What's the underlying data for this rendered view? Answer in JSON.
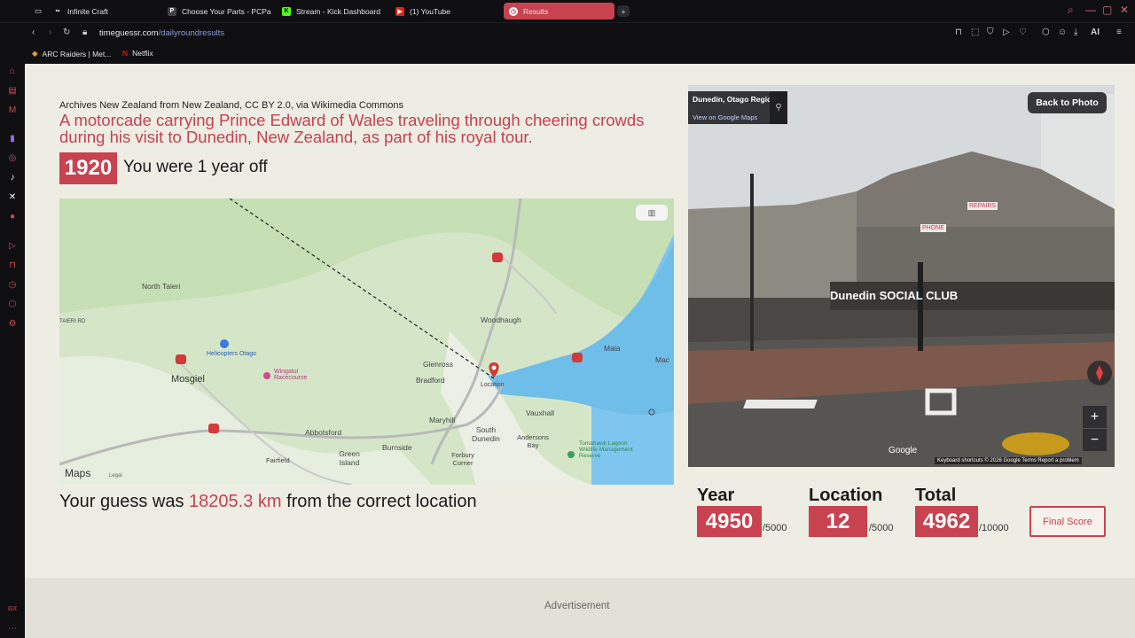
{
  "browser": {
    "tabs": [
      {
        "label": "Infinite Craft",
        "icon": "infinity-icon"
      },
      {
        "label": "Choose Your Parts - PCPa",
        "icon": "pcpartpicker-icon"
      },
      {
        "label": "Stream - Kick Dashboard",
        "icon": "kick-icon"
      },
      {
        "label": "(1) YouTube",
        "icon": "youtube-icon"
      },
      {
        "label": "Results",
        "icon": "timeguessr-icon"
      }
    ],
    "url_domain": "timeguessr.com",
    "url_path": "/dailyroundresults",
    "bookmarks": [
      {
        "label": "ARC Raiders | Met..."
      },
      {
        "label": "Netflix"
      }
    ],
    "accent": "#c9424f",
    "ai_label": "AI",
    "gx_label": "GX"
  },
  "result": {
    "credit": "Archives New Zealand from New Zealand, CC BY 2.0, via Wikimedia Commons",
    "caption": "A motorcade carrying Prince Edward of Wales traveling through cheering crowds during his visit to Dunedin, New Zealand, as part of his royal tour.",
    "year": "1920",
    "off_text": "You were 1 year off",
    "guess_prefix": "Your guess was ",
    "guess_distance": "18205.3 km",
    "guess_suffix": " from the correct location"
  },
  "map": {
    "labels": {
      "north_taieri": "North Taieri",
      "woodhaugh": "Woodhaugh",
      "helicopters": "Helicopters Otago",
      "wingatui": "Wingatui Racecourse",
      "mosgiel": "Mosgiel",
      "glenross": "Glenross",
      "bradford": "Bradford",
      "location": "Location",
      "maia": "Maia",
      "mac": "Mac",
      "maryhill": "Maryhill",
      "vauxhall": "Vauxhall",
      "abbotsford": "Abbotsford",
      "south_dunedin": "South Dunedin",
      "andersons_bay": "Andersons Bay",
      "tomahawk": "Tomahawk Lagoon Wildlife Management Reserve",
      "fairfield": "Fairfield",
      "green_island": "Green Island",
      "burnside": "Burnside",
      "forbury": "Forbury Corner",
      "taieri_rd": "TAIERI RD"
    },
    "route_shields": [
      "1",
      "87",
      "88",
      "1"
    ],
    "maps_logo": "Maps",
    "legal": "Legal"
  },
  "photo": {
    "location": "Dunedin, Otago Region",
    "view_link": "View on Google Maps",
    "back_button": "Back to Photo",
    "zoom_in": "+",
    "zoom_out": "−",
    "google_mark": "Google",
    "footer": "Keyboard shortcuts   © 2026 Google   Terms   Report a problem",
    "signs": {
      "social": "Dunedin SOCIAL CLUB",
      "repairs": "REPAIRS",
      "phone": "PHONE"
    }
  },
  "scores": {
    "year_label": "Year",
    "year_value": "4950",
    "year_max": "/5000",
    "location_label": "Location",
    "location_value": "12",
    "location_max": "/5000",
    "total_label": "Total",
    "total_value": "4962",
    "total_max": "/10000",
    "final_button": "Final Score"
  },
  "advertisement": "Advertisement"
}
